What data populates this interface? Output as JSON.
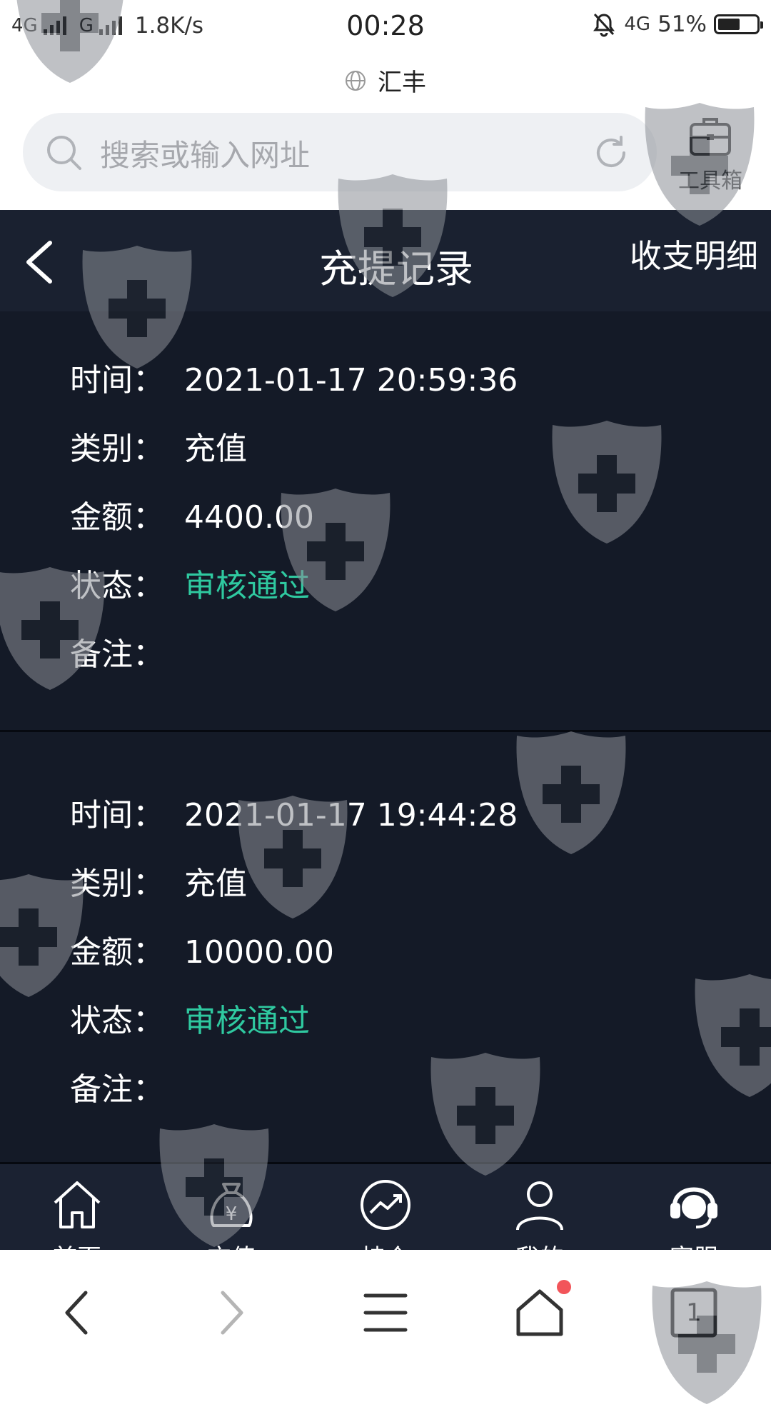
{
  "status_bar": {
    "network_left": "4G",
    "network_mid": "G",
    "speed": "1.8K/s",
    "time": "00:28",
    "network_right": "4G",
    "battery": "51%"
  },
  "browser": {
    "site_title": "汇丰",
    "search_placeholder": "搜索或输入网址",
    "toolbox_label": "工具箱",
    "tab_count": "1",
    "icons": [
      "globe-icon",
      "search-icon",
      "refresh-icon",
      "toolbox-icon",
      "back-arrow-icon",
      "forward-arrow-icon",
      "menu-icon",
      "home-icon",
      "tabs-icon"
    ]
  },
  "header": {
    "title": "充提记录",
    "right_link": "收支明细"
  },
  "labels": {
    "time": "时间：",
    "type": "类别：",
    "amount": "金额：",
    "status": "状态：",
    "remark": "备注："
  },
  "records": [
    {
      "time": "2021-01-17 20:59:36",
      "type": "充值",
      "amount": "4400.00",
      "status": "审核通过",
      "remark": ""
    },
    {
      "time": "2021-01-17 19:44:28",
      "type": "充值",
      "amount": "10000.00",
      "status": "审核通过",
      "remark": ""
    }
  ],
  "tabbar": {
    "items": [
      {
        "label": "首页",
        "icon": "home-icon"
      },
      {
        "label": "充值",
        "icon": "money-bag-icon"
      },
      {
        "label": "持仓",
        "icon": "trend-chart-icon"
      },
      {
        "label": "我的",
        "icon": "user-icon"
      },
      {
        "label": "客服",
        "icon": "headset-icon"
      }
    ]
  },
  "colors": {
    "app_background": "#111827",
    "header_background": "#1a2130",
    "status_approved": "#2fc9a0",
    "notification_dot": "#f2555a"
  }
}
